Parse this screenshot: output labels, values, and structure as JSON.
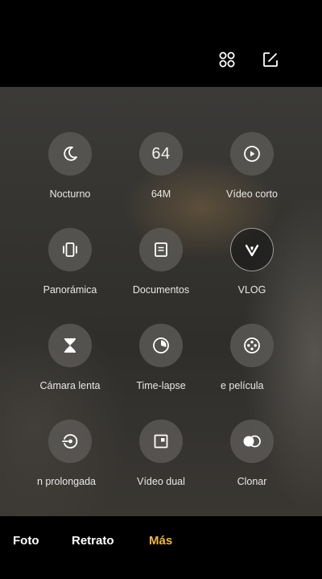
{
  "top_actions": {
    "grid_icon": "apps-grid-icon",
    "edit_icon": "edit-icon"
  },
  "modes": [
    {
      "label": "Nocturno",
      "icon": "moon-icon"
    },
    {
      "label": "64M",
      "icon": "64-text"
    },
    {
      "label": "Vídeo corto",
      "icon": "play-circle-icon"
    },
    {
      "label": "Panorámica",
      "icon": "panorama-icon"
    },
    {
      "label": "Documentos",
      "icon": "document-icon"
    },
    {
      "label": "VLOG",
      "icon": "vlog-heart-icon"
    },
    {
      "label": "Cámara lenta",
      "icon": "hourglass-icon"
    },
    {
      "label": "Time-lapse",
      "icon": "timer-icon"
    },
    {
      "label": "e película",
      "icon": "film-reel-icon"
    },
    {
      "label": "n prolongada",
      "icon": "long-exposure-icon"
    },
    {
      "label": "Vídeo dual",
      "icon": "dual-video-icon"
    },
    {
      "label": "Clonar",
      "icon": "clone-icon"
    }
  ],
  "mode_64_text": "64",
  "bottom_tabs": {
    "foto": "Foto",
    "retrato": "Retrato",
    "mas": "Más"
  },
  "colors": {
    "accent": "#f0b83a",
    "background": "#000000",
    "circle": "#5a5855"
  }
}
